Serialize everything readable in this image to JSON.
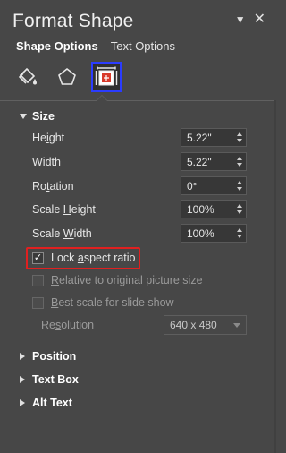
{
  "pane": {
    "title": "Format Shape",
    "controls": {
      "menu_glyph": "▼",
      "close_glyph": "✕"
    }
  },
  "tabs": {
    "active": "Shape Options",
    "other": "Text Options"
  },
  "icons": {
    "fill_line": "fill-bucket-icon",
    "effects": "pentagon-icon",
    "size_properties": "size-properties-icon"
  },
  "size": {
    "heading": "Size",
    "height": {
      "label_pre": "He",
      "label_u": "i",
      "label_post": "ght",
      "value": "5.22\""
    },
    "width": {
      "label_pre": "Wi",
      "label_u": "d",
      "label_post": "th",
      "value": "5.22\""
    },
    "rotation": {
      "label_pre": "Ro",
      "label_u": "t",
      "label_post": "ation",
      "value": "0°"
    },
    "scale_height": {
      "label_pre": "Scale ",
      "label_u": "H",
      "label_post": "eight",
      "value": "100%"
    },
    "scale_width": {
      "label_pre": "Scale ",
      "label_u": "W",
      "label_post": "idth",
      "value": "100%"
    },
    "lock_aspect": {
      "label_pre": "Lock ",
      "label_u": "a",
      "label_post": "spect ratio",
      "checked": true,
      "check_glyph": "✓"
    },
    "relative": {
      "label_pre": "",
      "label_u": "R",
      "label_post": "elative to original picture size",
      "checked": false
    },
    "best_scale": {
      "label_pre": "",
      "label_u": "B",
      "label_post": "est scale for slide show",
      "checked": false
    },
    "resolution": {
      "label_pre": "Re",
      "label_u": "s",
      "label_post": "olution",
      "value": "640 x 480"
    }
  },
  "sections": {
    "position": "Position",
    "text_box": "Text Box",
    "alt_text": "Alt Text"
  },
  "colors": {
    "highlight": "#e02020",
    "selected_icon_border": "#2b3cff"
  }
}
